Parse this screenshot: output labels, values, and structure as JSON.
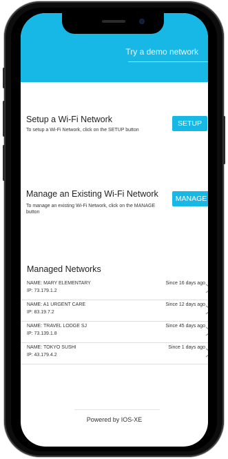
{
  "header": {
    "demo_link": "Try a demo network"
  },
  "setup": {
    "title": "Setup a Wi-Fi Network",
    "description": "To setup a Wi-Fi Network, click on the SETUP button",
    "button_label": "SETUP"
  },
  "manage": {
    "title": "Manage an Existing Wi-Fi Network",
    "description": "To manage an existing Wi-Fi Network, click on the MANAGE button",
    "button_label": "MANAGE"
  },
  "networks": {
    "title": "Managed Networks",
    "items": [
      {
        "name": "NAME: MARY ELEMENTARY",
        "ip": "IP: 73.179.1.2",
        "since": "Since 16 days ago"
      },
      {
        "name": "NAME: A1 URGENT CARE",
        "ip": "IP: 83.19.7.2",
        "since": "Since 12 days ago"
      },
      {
        "name": "NAME: TRAVEL LODGE SJ",
        "ip": "IP: 73.139.1.8",
        "since": "Since 45 days ago"
      },
      {
        "name": "NAME: TOKYO SUSHI",
        "ip": "IP: 43.179.4.2",
        "since": "Since 1 days ago"
      }
    ]
  },
  "footer": {
    "text": "Powered by IOS-XE"
  },
  "colors": {
    "accent": "#18b8e6"
  }
}
